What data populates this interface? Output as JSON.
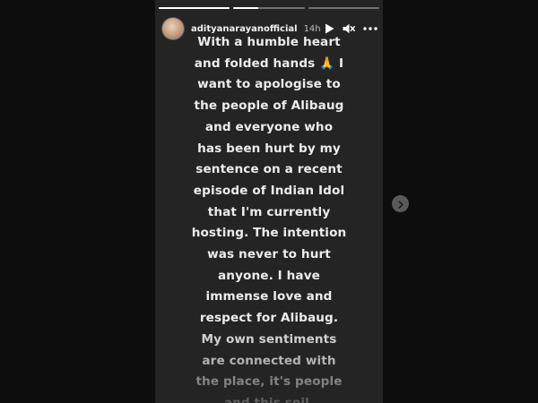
{
  "story": {
    "progress": [
      1,
      0.35,
      0
    ],
    "username": "adityanarayanofficial",
    "timestamp": "14h",
    "controls": {
      "play_icon": "play-icon",
      "mute_icon": "speaker-muted-icon",
      "more_icon": "more-horizontal-icon"
    },
    "caption_lines": [
      "With a humble heart",
      "and folded hands 🙏 I",
      "want to apologise to",
      "the people of Alibaug",
      "and everyone who",
      "has been hurt by my",
      "sentence on a recent",
      "episode of Indian Idol",
      "that I'm currently",
      "hosting. The intention",
      "was never to hurt",
      "anyone. I have",
      "immense love and",
      "respect for Alibaug.",
      "My own sentiments",
      "are connected with",
      "the place, it's people",
      "and this soil."
    ]
  },
  "navigation": {
    "next_icon": "chevron-right-icon"
  },
  "colors": {
    "page_background": "#0d0d0d",
    "story_background": "#242424",
    "text": "#ececec"
  }
}
